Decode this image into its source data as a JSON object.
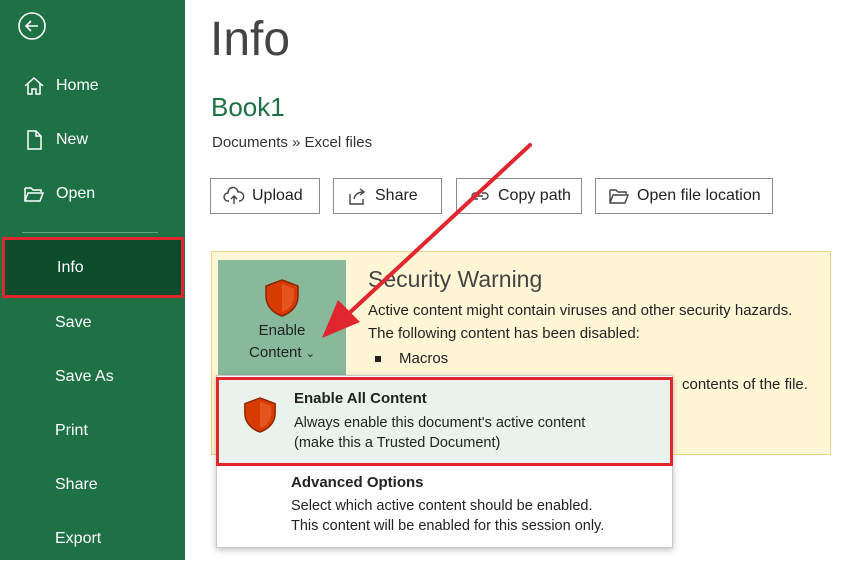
{
  "sidebar": {
    "items": [
      {
        "label": "Home",
        "icon": "home-icon"
      },
      {
        "label": "New",
        "icon": "new-document-icon"
      },
      {
        "label": "Open",
        "icon": "open-folder-icon"
      },
      {
        "label": "Info",
        "selected": true
      },
      {
        "label": "Save"
      },
      {
        "label": "Save As"
      },
      {
        "label": "Print"
      },
      {
        "label": "Share"
      },
      {
        "label": "Export"
      }
    ]
  },
  "main": {
    "title": "Info",
    "book_name": "Book1",
    "path": "Documents » Excel files",
    "buttons": [
      {
        "label": "Upload",
        "icon": "upload-cloud-icon"
      },
      {
        "label": "Share",
        "icon": "share-icon"
      },
      {
        "label": "Copy path",
        "icon": "link-icon"
      },
      {
        "label": "Open file location",
        "icon": "folder-icon"
      }
    ]
  },
  "security_warning": {
    "enable_label_line1": "Enable",
    "enable_label_line2": "Content",
    "title": "Security Warning",
    "line1": "Active content might contain viruses and other security hazards.",
    "line2": "The following content has been disabled:",
    "bullet": "Macros",
    "line3": "contents of the file."
  },
  "dropdown": {
    "enable_all_title": "Enable All Content",
    "enable_all_desc1": "Always enable this document's active content",
    "enable_all_desc2": "(make this a Trusted Document)",
    "advanced_title": "Advanced Options",
    "advanced_desc1": "Select which active content should be enabled.",
    "advanced_desc2": "This content will be enabled for this session only."
  },
  "colors": {
    "sidebar_bg": "#1e7145",
    "selected_bg": "#0e4d2c",
    "highlight_red": "#e0262e",
    "warning_bg": "#fff6d6",
    "shield_red": "#d83b01"
  }
}
